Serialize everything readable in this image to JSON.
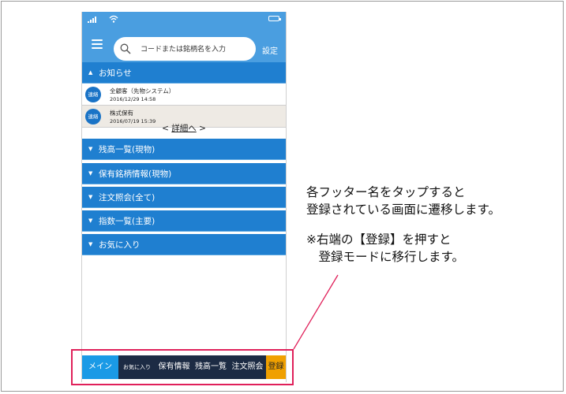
{
  "header": {
    "search_placeholder": "コードまたは銘柄名を入力",
    "settings_label": "設定"
  },
  "news": {
    "title": "お知らせ",
    "items": [
      {
        "badge": "連絡",
        "title": "全顧客（先物システム）",
        "date": "2016/12/29 14:58"
      },
      {
        "badge": "連絡",
        "title": "株式保有",
        "date": "2016/07/19 15:39"
      }
    ],
    "detail_link": {
      "prefix": "< ",
      "label": "詳細へ",
      "suffix": " >"
    }
  },
  "sections": [
    "残高一覧(現物)",
    "保有銘柄情報(現物)",
    "注文照会(全て)",
    "指数一覧(主要)",
    "お気に入り"
  ],
  "footer_tabs": [
    {
      "label": "メイン",
      "active": true
    },
    {
      "label": "お気に入り",
      "active": false
    },
    {
      "label": "保有情報",
      "active": false
    },
    {
      "label": "残高一覧",
      "active": false
    },
    {
      "label": "注文照会",
      "active": false
    },
    {
      "label": "登録",
      "active": false
    }
  ],
  "annotation": {
    "lines": [
      "各フッター名をタップすると",
      "登録されている画面に遷移します。",
      "※右端の【登録】を押すと",
      "　登録モードに移行します。"
    ]
  },
  "colors": {
    "header": "#4a9ee0",
    "section": "#1f7fd0",
    "footer": "#1c2b44",
    "active_tab": "#1a9ae6",
    "register_tab": "#f0a000",
    "highlight": "#e0205a"
  }
}
